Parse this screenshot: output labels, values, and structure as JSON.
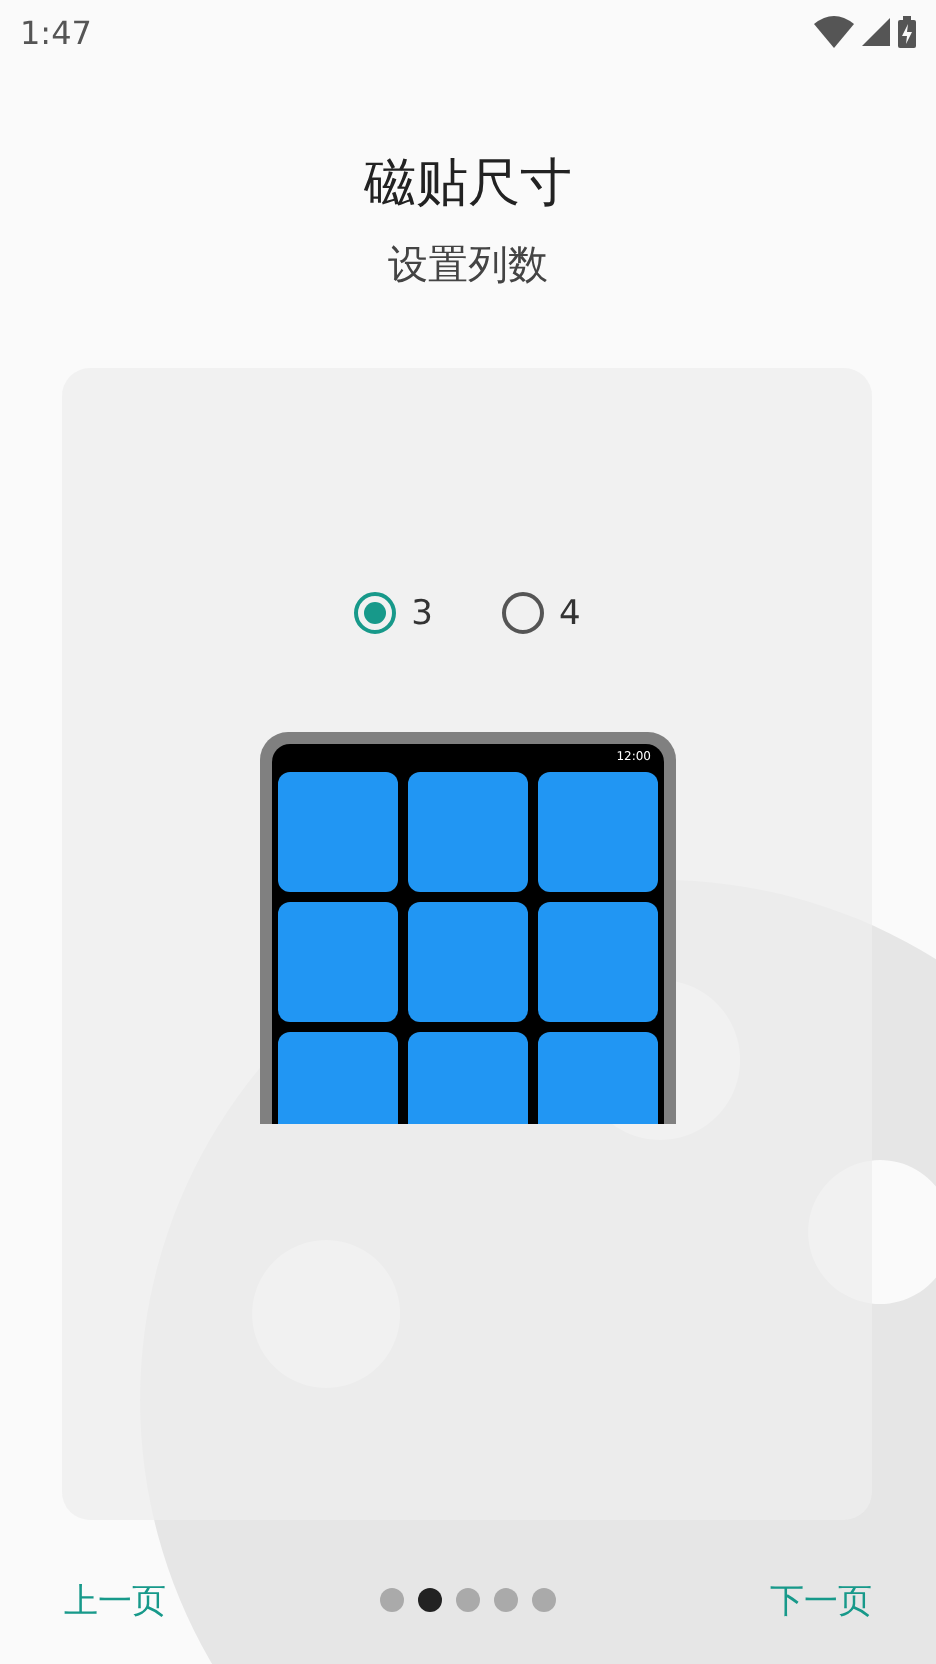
{
  "status_bar": {
    "time": "1:47"
  },
  "title": "磁贴尺寸",
  "subtitle": "设置列数",
  "options": [
    {
      "label": "3",
      "selected": true
    },
    {
      "label": "4",
      "selected": false
    }
  ],
  "preview": {
    "clock": "12:00"
  },
  "nav": {
    "back": "上一页",
    "next": "下一页"
  },
  "pages": [
    {
      "selected": false
    },
    {
      "selected": true
    },
    {
      "selected": false
    },
    {
      "selected": false
    },
    {
      "selected": false
    }
  ]
}
